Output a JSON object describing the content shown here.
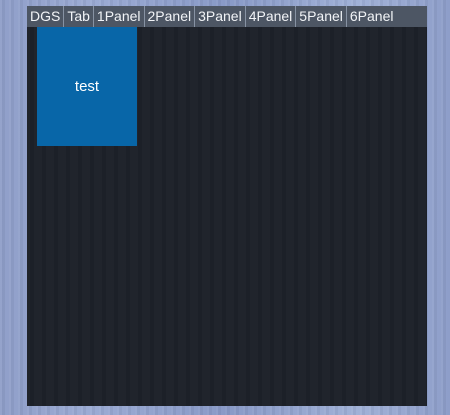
{
  "tabs": [
    {
      "label": "DGS"
    },
    {
      "label": "Tab"
    },
    {
      "label": "1Panel"
    },
    {
      "label": "2Panel"
    },
    {
      "label": "3Panel"
    },
    {
      "label": "4Panel"
    },
    {
      "label": "5Panel"
    },
    {
      "label": "6Panel"
    }
  ],
  "tile": {
    "label": "test",
    "color": "#0866a8"
  },
  "colors": {
    "window_background": "#1d2129",
    "tabbar_background": "#4d5664",
    "desktop_background": "#9aaad3"
  }
}
